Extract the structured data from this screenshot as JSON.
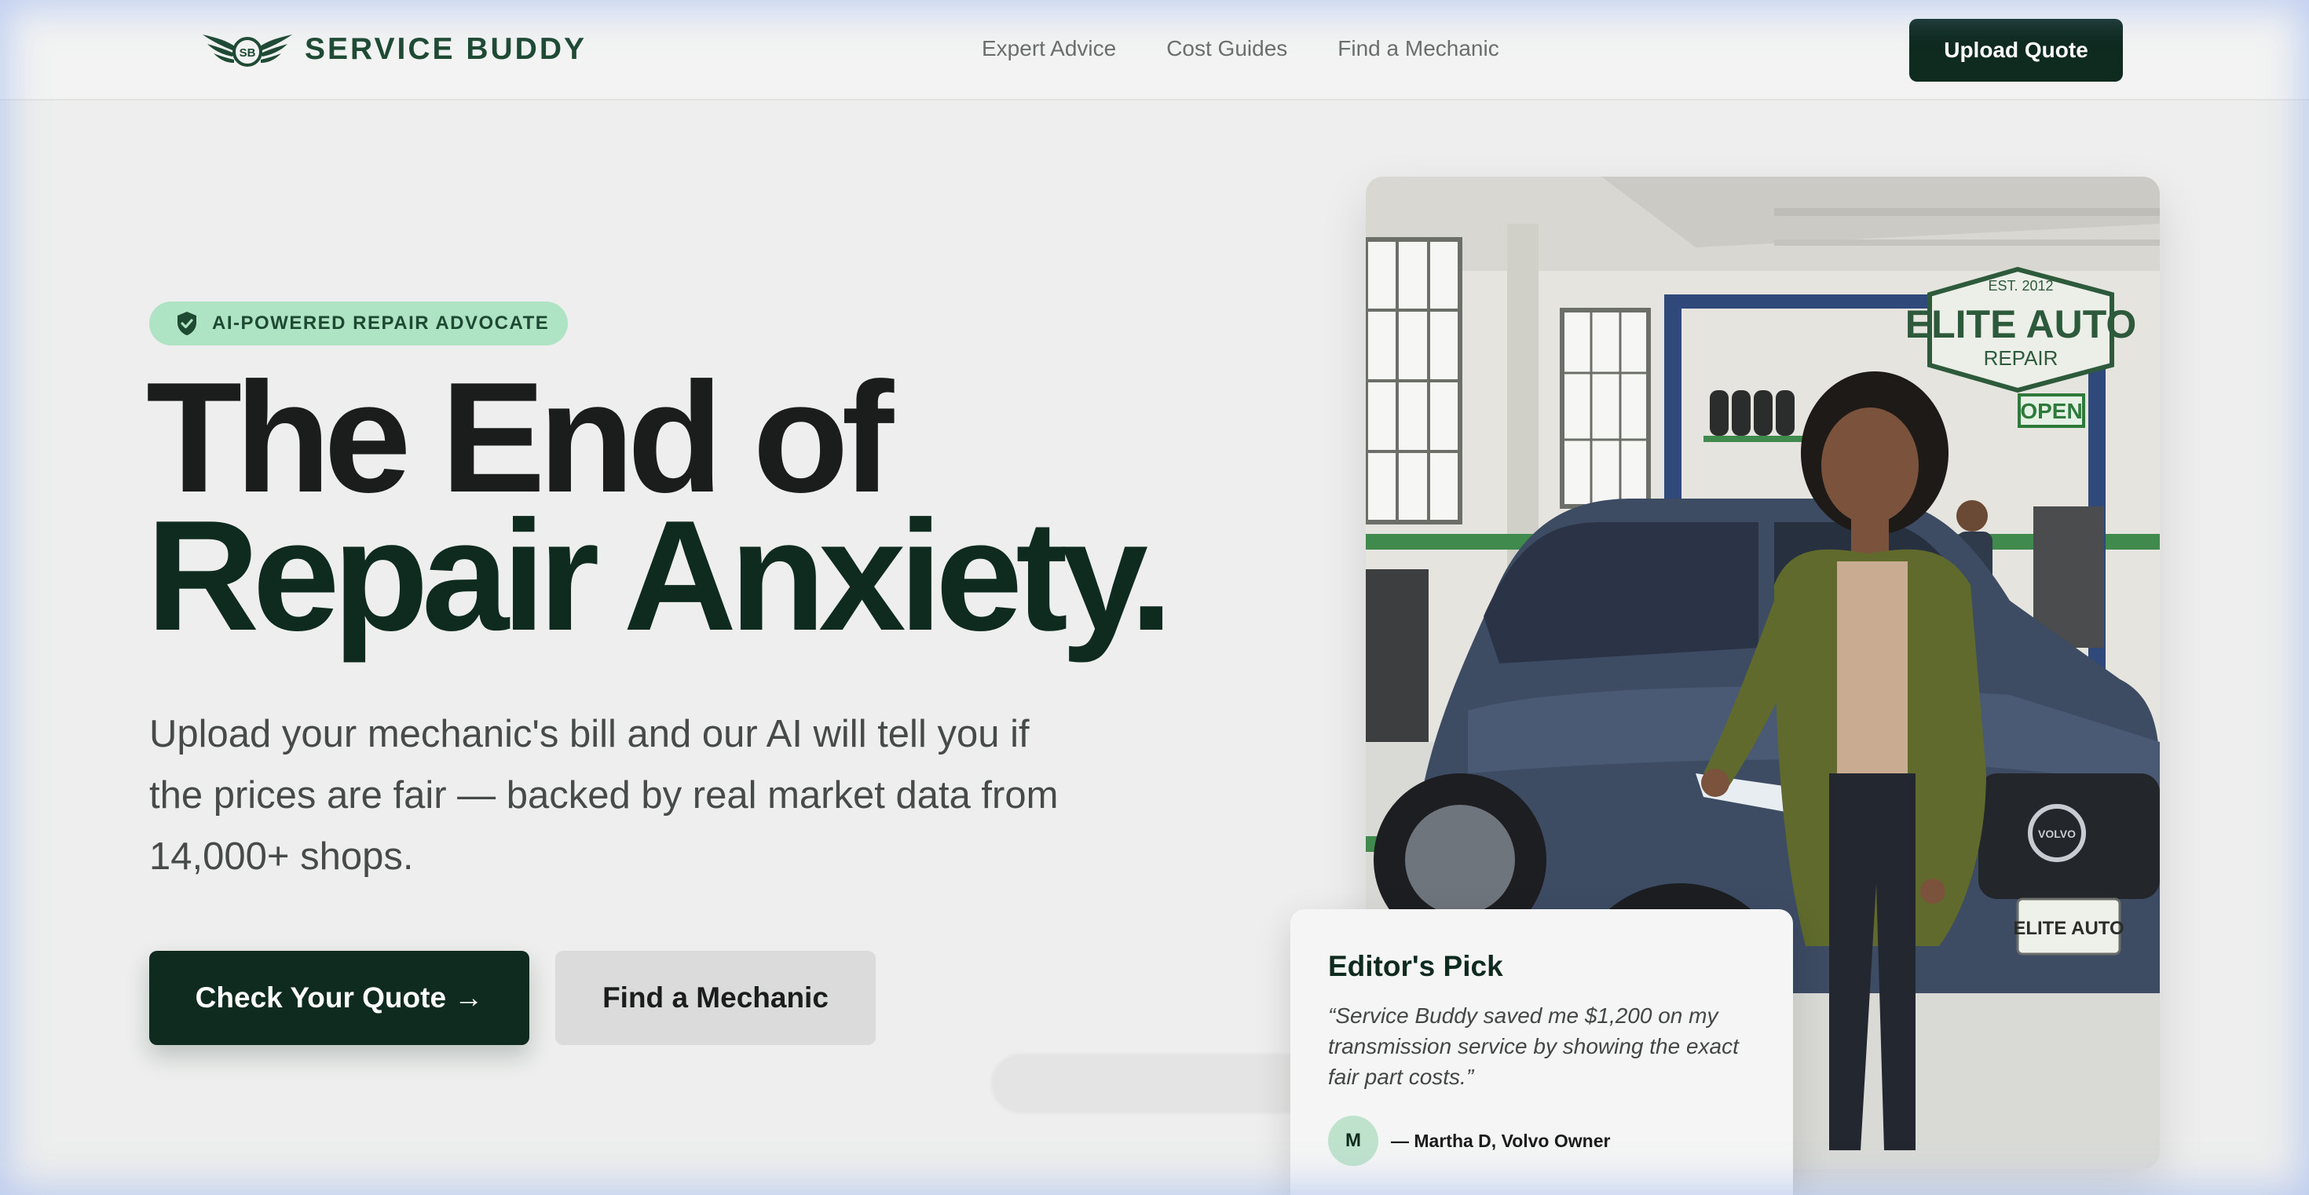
{
  "brand": {
    "name": "SERVICE BUDDY",
    "monogram": "SB",
    "colors": {
      "primary": "#0f2a1f",
      "brand_green": "#1f4a34",
      "badge_bg": "#aee4c3",
      "page_bg": "#edeeed"
    }
  },
  "nav": {
    "links": [
      {
        "label": "Expert Advice"
      },
      {
        "label": "Cost Guides"
      },
      {
        "label": "Find a Mechanic"
      }
    ],
    "cta_label": "Upload Quote"
  },
  "hero": {
    "badge": {
      "icon": "shield-check-icon",
      "label": "AI-POWERED REPAIR ADVOCATE"
    },
    "headline_line1": "The End of",
    "headline_line2": "Repair Anxiety.",
    "subtext": "Upload your mechanic's bill and our AI will tell you if the prices are fair — backed by real market data from 14,000+ shops.",
    "primary_cta": "Check Your Quote →",
    "secondary_cta": "Find a Mechanic"
  },
  "hero_image": {
    "sign_line1": "EST. 2012",
    "sign_line2": "ELITE AUTO",
    "sign_line3": "REPAIR",
    "open_sign": "OPEN",
    "plate": "ELITE AUTO",
    "car_badge": "VOLVO"
  },
  "editor_card": {
    "title": "Editor's Pick",
    "quote": "“Service Buddy saved me $1,200 on my transmission service by showing the exact fair part costs.”",
    "avatar_initial": "M",
    "author": "— Martha D, Volvo Owner"
  }
}
